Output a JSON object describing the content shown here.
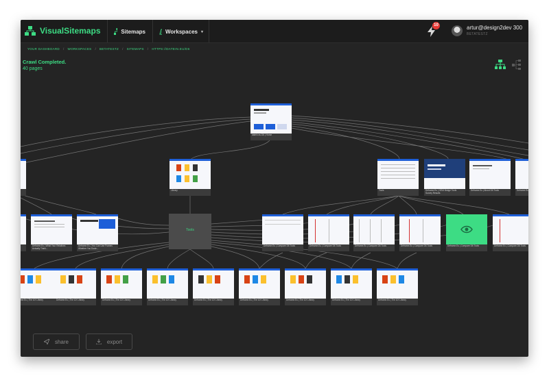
{
  "app": {
    "name": "VisualSitemaps"
  },
  "nav": {
    "sitemaps": "Sitemaps",
    "workspaces": "Workspaces"
  },
  "notifications": {
    "count": "10"
  },
  "user": {
    "email": "artur@design2dev 300",
    "sub": "BETATESTZ"
  },
  "breadcrumb": [
    "YOUR DASHBOARD",
    "WORKSPACES",
    "BETATESTZ",
    "SITEMAPS",
    "HTTPS://DATEIN.EU/D6"
  ],
  "status": {
    "title": "Crawl Completed.",
    "pages": "40 pages"
  },
  "actions": {
    "share": "share",
    "export": "export"
  },
  "colors": {
    "accent": "#3ddc84",
    "header_blue": "#1e5fd8",
    "bg": "#242424"
  },
  "nodes": {
    "root": "datein.eu.D6 | Home",
    "library": "Library",
    "hub": "Tools",
    "r1": "Tools",
    "r2": "Deframe.Eu | OEM Bridge Tools Survey Results",
    "r3": "Deframe.Eu | About D6 Tools",
    "r4": "Deframe.Eu | Survey",
    "l3": "Deframe.Eu | What Your Relatives Actually Think...",
    "l4": "Deframe.Eu | You Can Use Frames Whether You Dude...",
    "c1": "Deframe.Eu | Compare D6 Tools",
    "c2": "Deframe.Eu | Compare D6 Tools",
    "c3": "Deframe.Eu | Compare D6 Tools",
    "c4": "Deframe.Eu | Compare D6 Tools",
    "c5": "Deframe.Eu | Compare D6 Tools",
    "c6": "Deframe.Eu | Compare D6 Tools",
    "b": "Deframe.Eu | The UX Library"
  }
}
